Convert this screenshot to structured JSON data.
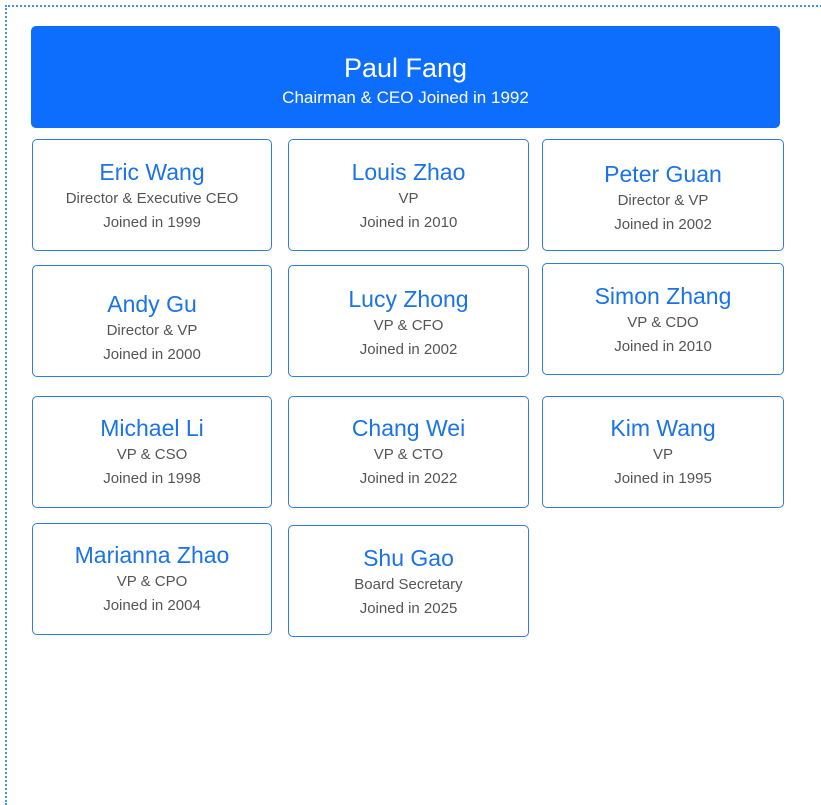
{
  "chart_data": {
    "type": "org-chart",
    "root": {
      "name": "Paul Fang",
      "role": "Chairman & CEO Joined in 1992"
    },
    "members": [
      {
        "name": "Eric Wang",
        "title": "Director  & Executive CEO",
        "joined": "Joined in 1999"
      },
      {
        "name": "Louis Zhao",
        "title": "VP",
        "joined": "Joined in 2010"
      },
      {
        "name": "Peter Guan",
        "title": "Director & VP",
        "joined": "Joined in 2002"
      },
      {
        "name": "Andy Gu",
        "title": "Director  & VP",
        "joined": "Joined in 2000"
      },
      {
        "name": "Lucy Zhong",
        "title": "VP & CFO",
        "joined": "Joined in 2002"
      },
      {
        "name": "Simon Zhang",
        "title": "VP & CDO",
        "joined": "Joined in 2010"
      },
      {
        "name": "Michael  Li",
        "title": "VP & CSO",
        "joined": "Joined in 1998"
      },
      {
        "name": "Chang Wei",
        "title": "VP & CTO",
        "joined": "Joined in 2022"
      },
      {
        "name": "Kim Wang",
        "title": "VP",
        "joined": "Joined in 1995"
      },
      {
        "name": "Marianna Zhao",
        "title": "VP & CPO",
        "joined": "Joined in 2004"
      },
      {
        "name": "Shu Gao",
        "title": "Board Secretary",
        "joined": "Joined in 2025"
      }
    ]
  },
  "colors": {
    "root_fill": "#0d6efd",
    "card_border": "#2b7de9",
    "name_text": "#1a73e8",
    "detail_text": "#555555",
    "frame_border": "#4a90e2"
  }
}
